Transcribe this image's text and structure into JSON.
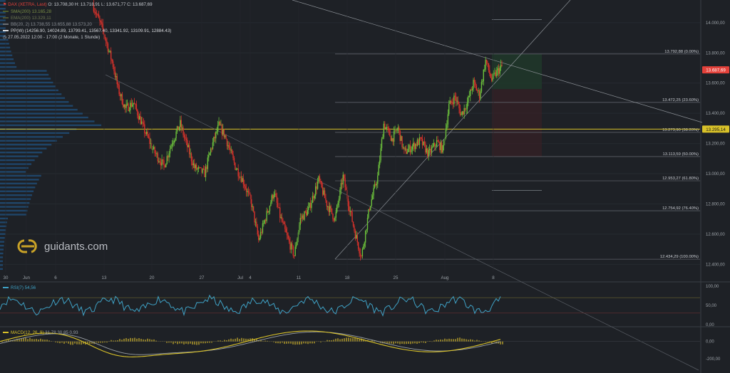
{
  "header": {
    "instrument": "DAX (XETRA, Last)",
    "ohlc": "O: 13.708,30  H: 13.718,91  L: 13.671,77  C: 13.687,69",
    "sma200": "SMA(200)  13.165,28",
    "ema200": "EMA(200)  13.329,11",
    "bb": "BB(20, 2)  13.738,55  13.655,88  13.573,20",
    "ppw": "PP(W)  (14256.90, 14024.89, 13799.41, 13567.40, 13341.92, 13109.91, 12884.43)",
    "range": "27.05.2022 12:00 - 17:00  (2 Monate, 1 Stunde)"
  },
  "logo": {
    "text": "guidants.com"
  },
  "colors": {
    "bg": "#1e2126",
    "up": "#6bbf3b",
    "down": "#d9322b",
    "fib": "#c9ccd2",
    "price": "#e3413a",
    "yellow": "#d9c229",
    "rsi": "#3fa2c6",
    "profile": "#1f4f7a"
  },
  "chart_data": {
    "type": "candlestick",
    "yaxis": {
      "min": 12350,
      "max": 14150,
      "ticks": [
        "14.000,00",
        "13.800,00",
        "13.600,00",
        "13.400,00",
        "13.200,00",
        "13.000,00",
        "12.800,00",
        "12.600,00",
        "12.400,00"
      ]
    },
    "xaxis_labels": [
      "30",
      "Jun",
      "6",
      "13",
      "20",
      "27",
      "Jul",
      "4",
      "11",
      "18",
      "25",
      "Aug",
      "8"
    ],
    "fib_levels": [
      {
        "price": 13792.88,
        "label": "13.792,88 (0.00%)"
      },
      {
        "price": 13472.25,
        "label": "13.472,25 (23.60%)"
      },
      {
        "price": 13273.9,
        "label": "13.273,90 (38.20%)"
      },
      {
        "price": 13113.59,
        "label": "13.113,59 (50.00%)"
      },
      {
        "price": 12953.27,
        "label": "12.953,27 (61.80%)"
      },
      {
        "price": 12754.92,
        "label": "12.754,92 (76.40%)"
      },
      {
        "price": 12434.29,
        "label": "12.434,29 (100.00%)"
      }
    ],
    "last_price": {
      "value": 13687.69,
      "label": "13.687,69"
    },
    "yellow_level": {
      "value": 13295.14,
      "label": "13.295,14"
    },
    "close_path": [
      [
        0,
        14120
      ],
      [
        10,
        13950
      ],
      [
        20,
        13720
      ],
      [
        25,
        13560
      ],
      [
        32,
        13430
      ],
      [
        40,
        13470
      ],
      [
        50,
        13300
      ],
      [
        60,
        13150
      ],
      [
        70,
        13050
      ],
      [
        78,
        13210
      ],
      [
        86,
        13330
      ],
      [
        92,
        13200
      ],
      [
        100,
        13040
      ],
      [
        110,
        13000
      ],
      [
        116,
        13160
      ],
      [
        124,
        13320
      ],
      [
        130,
        13250
      ],
      [
        140,
        13050
      ],
      [
        148,
        12950
      ],
      [
        156,
        12800
      ],
      [
        163,
        12560
      ],
      [
        170,
        12710
      ],
      [
        178,
        12880
      ],
      [
        184,
        12720
      ],
      [
        192,
        12560
      ],
      [
        198,
        12460
      ],
      [
        204,
        12700
      ],
      [
        212,
        12760
      ],
      [
        222,
        12960
      ],
      [
        230,
        12800
      ],
      [
        238,
        12700
      ],
      [
        246,
        12980
      ],
      [
        252,
        12780
      ],
      [
        258,
        12600
      ],
      [
        264,
        12450
      ],
      [
        272,
        12780
      ],
      [
        280,
        12980
      ],
      [
        286,
        13330
      ],
      [
        294,
        13230
      ],
      [
        300,
        13300
      ],
      [
        306,
        13140
      ],
      [
        314,
        13180
      ],
      [
        322,
        13220
      ],
      [
        330,
        13130
      ],
      [
        338,
        13210
      ],
      [
        344,
        13160
      ],
      [
        350,
        13450
      ],
      [
        356,
        13510
      ],
      [
        362,
        13390
      ],
      [
        368,
        13470
      ],
      [
        374,
        13600
      ],
      [
        380,
        13520
      ],
      [
        386,
        13750
      ],
      [
        392,
        13620
      ],
      [
        398,
        13680
      ],
      [
        402,
        13710
      ]
    ],
    "rsi": {
      "label": "RSI(7)",
      "value": "54,56",
      "ticks": [
        "100,00",
        "50,00",
        "0,00"
      ]
    },
    "macd": {
      "label": "MACD(12, 26, 9)",
      "values": "31,78  30,85  0,93",
      "ticks": [
        "0,00",
        "-200,00"
      ]
    }
  }
}
